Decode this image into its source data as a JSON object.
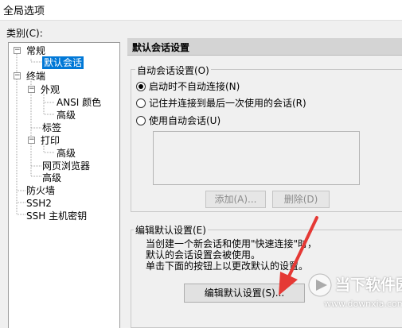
{
  "window": {
    "title": "全局选项"
  },
  "category_label": "类别(C):",
  "tree": [
    {
      "label": "常规",
      "expander": "−"
    },
    {
      "label": "默认会话",
      "selected": true
    },
    {
      "label": "终端",
      "expander": "−"
    },
    {
      "label": "外观",
      "expander": "−"
    },
    {
      "label": "ANSI 颜色"
    },
    {
      "label": "高级"
    },
    {
      "label": "标签"
    },
    {
      "label": "打印",
      "expander": "−"
    },
    {
      "label": "高级"
    },
    {
      "label": "网页浏览器"
    },
    {
      "label": "高级"
    },
    {
      "label": "防火墙"
    },
    {
      "label": "SSH2"
    },
    {
      "label": "SSH 主机密钥"
    }
  ],
  "panel": {
    "header": "默认会话设置",
    "auto_session_group": "自动会话设置(O)",
    "radios": [
      {
        "label": "启动时不自动连接(N)",
        "checked": true
      },
      {
        "label": "记住并连接到最后一次使用的会话(R)",
        "checked": false
      },
      {
        "label": "使用自动会话(U)",
        "checked": false
      }
    ],
    "add_button": "添加(A)...",
    "delete_button": "删除(D)",
    "edit_group": "编辑默认设置(E)",
    "description_lines": [
      "当创建一个新会话和使用\"快速连接\"时，",
      "默认的会话设置会被使用。",
      "单击下面的按钮上以更改默认的设置。"
    ],
    "edit_button": "编辑默认设置(S)..."
  },
  "watermark": {
    "brand": "当下软件园",
    "url": "www.downxia.com"
  },
  "colors": {
    "selection": "#0078d7",
    "arrow": "#e53935",
    "header_bg": "#d4d4d4"
  }
}
